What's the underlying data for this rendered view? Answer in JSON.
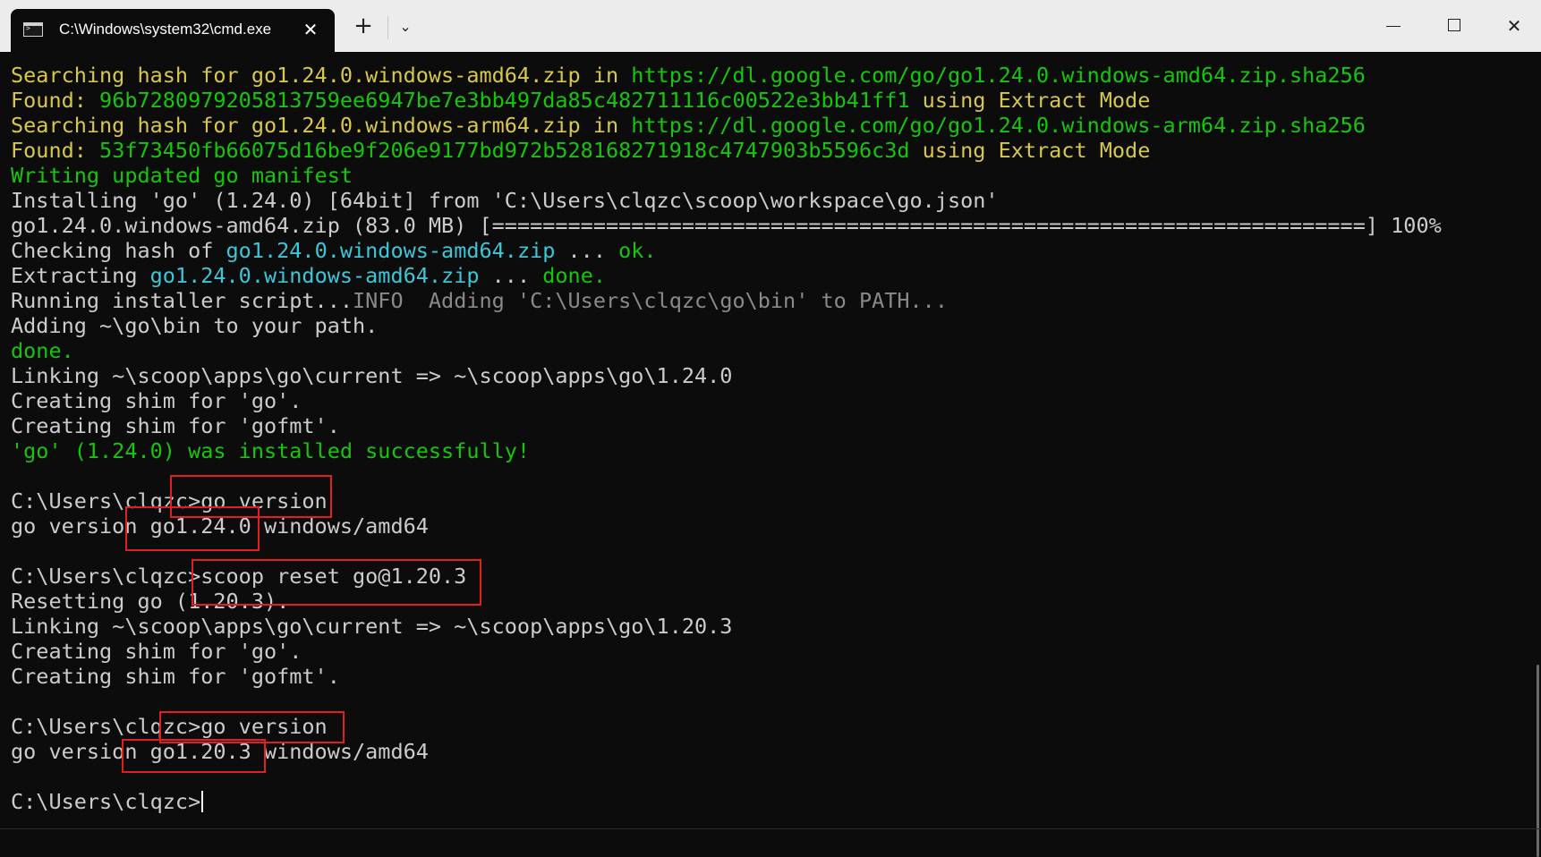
{
  "window": {
    "tab_title": "C:\\Windows\\system32\\cmd.exe",
    "tab_close_glyph": "✕",
    "new_tab_glyph": "+",
    "dropdown_glyph": "⌄",
    "close_glyph": "✕"
  },
  "colors": {
    "terminal_bg": "#0c0c0c",
    "yellow": "#d7c84a",
    "green": "#16c60c",
    "cyan": "#3cc7d9",
    "white": "#cccccc",
    "gray": "#8a8a8a",
    "highlight_box": "#e02020"
  },
  "terminal": {
    "lines": [
      [
        {
          "t": "Searching hash for go1.24.0.windows-amd64.zip in ",
          "c": "yellow"
        },
        {
          "t": "https://dl.google.com/go/go1.24.0.windows-amd64.zip.sha256",
          "c": "green"
        }
      ],
      [
        {
          "t": "Found: ",
          "c": "yellow"
        },
        {
          "t": "96b7280979205813759ee6947be7e3bb497da85c482711116c00522e3bb41ff1",
          "c": "green"
        },
        {
          "t": " using Extract Mode",
          "c": "yellow"
        }
      ],
      [
        {
          "t": "Searching hash for go1.24.0.windows-arm64.zip in ",
          "c": "yellow"
        },
        {
          "t": "https://dl.google.com/go/go1.24.0.windows-arm64.zip.sha256",
          "c": "green"
        }
      ],
      [
        {
          "t": "Found: ",
          "c": "yellow"
        },
        {
          "t": "53f73450fb66075d16be9f206e9177bd972b528168271918c4747903b5596c3d",
          "c": "green"
        },
        {
          "t": " using Extract Mode",
          "c": "yellow"
        }
      ],
      [
        {
          "t": "Writing updated go manifest",
          "c": "green"
        }
      ],
      [
        {
          "t": "Installing 'go' (1.24.0) [64bit] from 'C:\\Users\\clqzc\\scoop\\workspace\\go.json'",
          "c": "white"
        }
      ],
      [
        {
          "t": "go1.24.0.windows-amd64.zip (83.0 MB) [=====================================================================] 100%",
          "c": "white"
        }
      ],
      [
        {
          "t": "Checking hash of ",
          "c": "white"
        },
        {
          "t": "go1.24.0.windows-amd64.zip",
          "c": "cyan"
        },
        {
          "t": " ... ",
          "c": "white"
        },
        {
          "t": "ok.",
          "c": "green"
        }
      ],
      [
        {
          "t": "Extracting ",
          "c": "white"
        },
        {
          "t": "go1.24.0.windows-amd64.zip",
          "c": "cyan"
        },
        {
          "t": " ... ",
          "c": "white"
        },
        {
          "t": "done.",
          "c": "green"
        }
      ],
      [
        {
          "t": "Running installer script...",
          "c": "white"
        },
        {
          "t": "INFO  Adding 'C:\\Users\\clqzc\\go\\bin' to PATH...",
          "c": "gray"
        }
      ],
      [
        {
          "t": "Adding ~\\go\\bin to your path.",
          "c": "white"
        }
      ],
      [
        {
          "t": "done.",
          "c": "green"
        }
      ],
      [
        {
          "t": "Linking ~\\scoop\\apps\\go\\current => ~\\scoop\\apps\\go\\1.24.0",
          "c": "white"
        }
      ],
      [
        {
          "t": "Creating shim for 'go'.",
          "c": "white"
        }
      ],
      [
        {
          "t": "Creating shim for 'gofmt'.",
          "c": "white"
        }
      ],
      [
        {
          "t": "'go' (1.24.0) was installed successfully!",
          "c": "green"
        }
      ],
      [
        {
          "t": "",
          "c": "white"
        }
      ],
      [
        {
          "t": "C:\\Users\\clqzc>go version",
          "c": "white"
        }
      ],
      [
        {
          "t": "go version go1.24.0 windows/amd64",
          "c": "white"
        }
      ],
      [
        {
          "t": "",
          "c": "white"
        }
      ],
      [
        {
          "t": "C:\\Users\\clqzc>scoop reset go@1.20.3",
          "c": "white"
        }
      ],
      [
        {
          "t": "Resetting go (1.20.3).",
          "c": "white"
        }
      ],
      [
        {
          "t": "Linking ~\\scoop\\apps\\go\\current => ~\\scoop\\apps\\go\\1.20.3",
          "c": "white"
        }
      ],
      [
        {
          "t": "Creating shim for 'go'.",
          "c": "white"
        }
      ],
      [
        {
          "t": "Creating shim for 'gofmt'.",
          "c": "white"
        }
      ],
      [
        {
          "t": "",
          "c": "white"
        }
      ],
      [
        {
          "t": "C:\\Users\\clqzc>go version",
          "c": "white"
        }
      ],
      [
        {
          "t": "go version go1.20.3 windows/amd64",
          "c": "white"
        }
      ],
      [
        {
          "t": "",
          "c": "white"
        }
      ],
      [
        {
          "t": "C:\\Users\\clqzc>",
          "c": "white"
        }
      ]
    ],
    "cursor_line": 29
  }
}
